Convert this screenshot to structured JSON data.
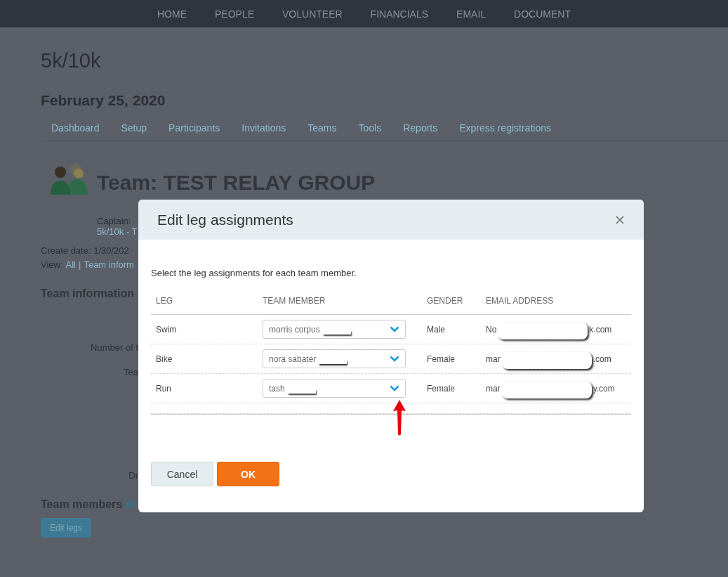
{
  "nav": [
    "HOME",
    "PEOPLE",
    "VOLUNTEER",
    "FINANCIALS",
    "EMAIL",
    "DOCUMENT"
  ],
  "page_title": "5k/10k",
  "date": "February 25, 2020",
  "tabs": [
    "Dashboard",
    "Setup",
    "Participants",
    "Invitations",
    "Teams",
    "Tools",
    "Reports",
    "Express registrations"
  ],
  "team_title": "Team: TEST RELAY GROUP",
  "captain_label": "Captain:",
  "captain_link": "5k/10k - T",
  "create_date": "Create date: 1/30/202",
  "view_label": "View:",
  "view_links": [
    "All",
    "Team inform"
  ],
  "view_separator": "|",
  "team_info_heading": "Team information",
  "info_labels": [
    {
      "label": "Number of t"
    },
    {
      "label": "Tea"
    },
    {
      "label": "Dr"
    }
  ],
  "team_members_heading": "Team members",
  "edit_legs_button": "Edit legs",
  "dialog": {
    "title": "Edit leg assignments",
    "instruction": "Select the leg assignments for each team member.",
    "columns": [
      "LEG",
      "TEAM MEMBER",
      "GENDER",
      "EMAIL ADDRESS"
    ],
    "rows": [
      {
        "leg": "Swim",
        "member": "morris corpus",
        "gender": "Male",
        "email_start": "No",
        "email_end": "k.com"
      },
      {
        "leg": "Bike",
        "member": "nora sabater",
        "gender": "Female",
        "email_start": "mar",
        "email_end": ".com"
      },
      {
        "leg": "Run",
        "member": "tash",
        "gender": "Female",
        "email_start": "mar",
        "email_end": "y.com"
      }
    ],
    "buttons": {
      "cancel": "Cancel",
      "ok": "OK"
    }
  }
}
